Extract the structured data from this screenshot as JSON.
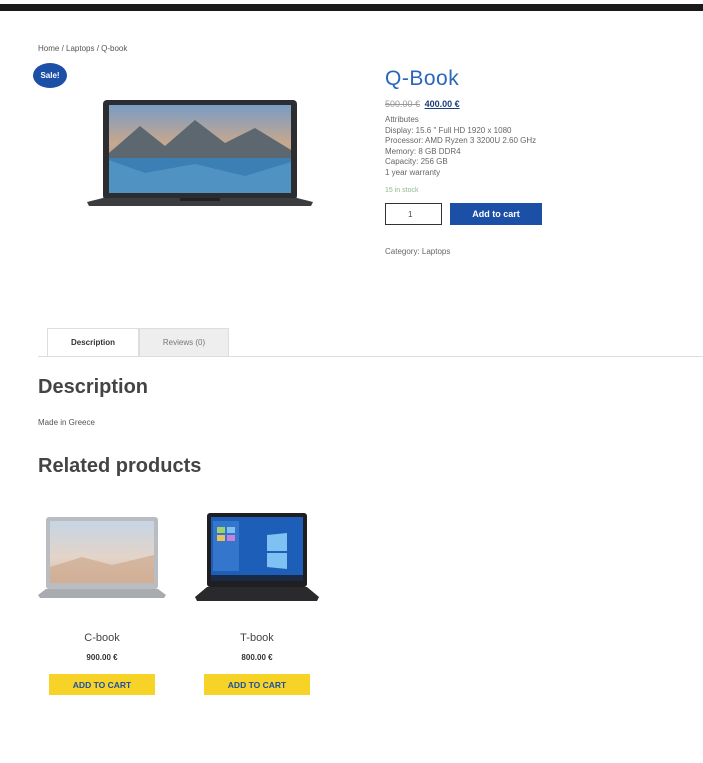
{
  "breadcrumb": "Home / Laptops / Q-book",
  "sale_badge": "Sale!",
  "product": {
    "title": "Q-Book",
    "old_price": "500.00 €",
    "price": "400.00 €",
    "attributes": [
      "Attributes",
      "Display: 15.6 \" Full HD 1920 x 1080",
      "Processor: AMD Ryzen 3 3200U 2.60 GHz",
      "Memory: 8 GB DDR4",
      "Capacity: 256 GB",
      "1 year warranty"
    ],
    "stock": "15 in stock",
    "quantity": "1",
    "add_to_cart": "Add to cart",
    "category": "Category: Laptops"
  },
  "tabs": [
    {
      "label": "Description",
      "active": true
    },
    {
      "label": "Reviews (0)",
      "active": false
    }
  ],
  "description": {
    "heading": "Description",
    "text": "Made in Greece"
  },
  "related": {
    "heading": "Related products",
    "items": [
      {
        "name": "C-book",
        "price": "900.00 €",
        "button": "ADD TO CART"
      },
      {
        "name": "T-book",
        "price": "800.00 €",
        "button": "ADD TO CART"
      }
    ]
  },
  "colors": {
    "accent_blue": "#1c4fa6",
    "title_blue": "#2a67b7",
    "button_yellow": "#f7d327"
  }
}
